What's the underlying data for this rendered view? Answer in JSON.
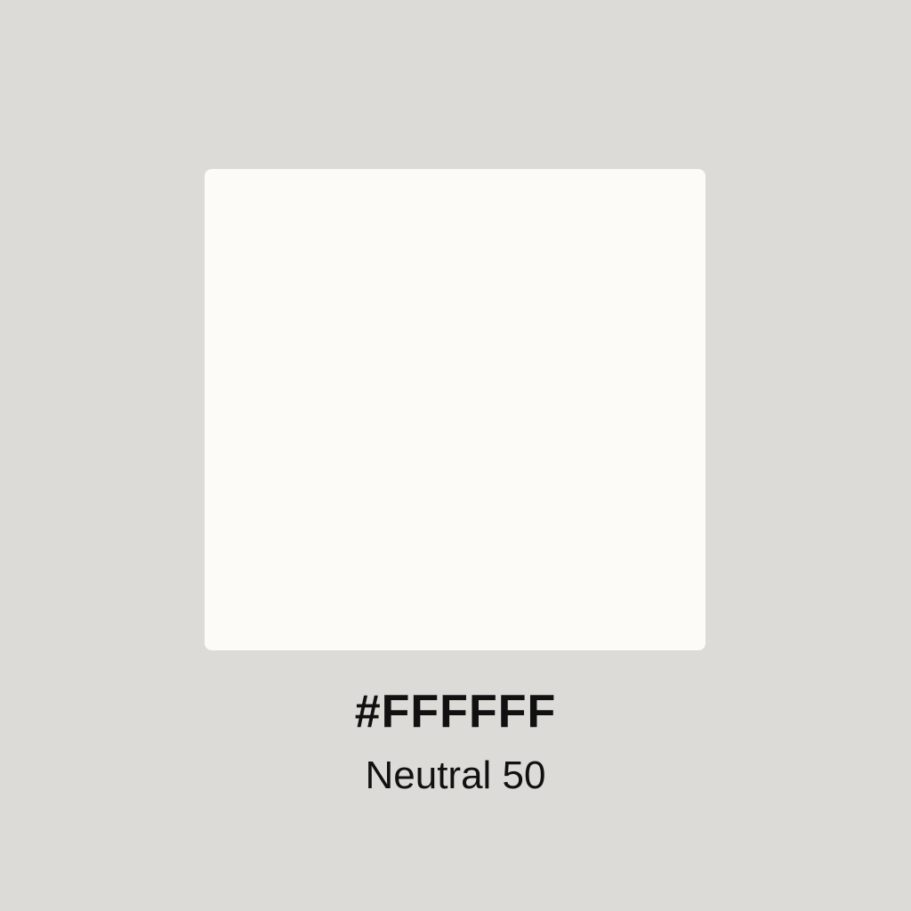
{
  "swatch": {
    "hex": "#FFFFFF",
    "name": "Neutral 50",
    "color": "#fcfbf8"
  },
  "background": {
    "color": "#dcdbd7"
  }
}
